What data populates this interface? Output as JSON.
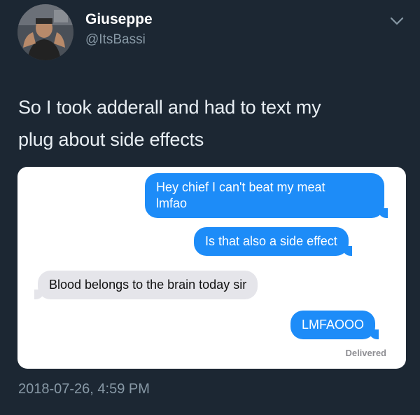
{
  "author": {
    "name": "Giuseppe",
    "handle": "@ItsBassi",
    "avatar_icon": "profile-photo"
  },
  "tweet": {
    "text_line1": "So I took adderall and had to text my",
    "text_line2": "plug about side effects",
    "timestamp": "2018-07-26, 4:59 PM"
  },
  "menu_icon": "chevron-down-icon",
  "conversation": {
    "messages": [
      {
        "from": "me",
        "line1": "Hey chief I can't beat my meat",
        "line2": "lmfao"
      },
      {
        "from": "me",
        "text": "Is that also a side effect"
      },
      {
        "from": "them",
        "text": "Blood belongs to the brain today sir"
      },
      {
        "from": "me",
        "text": "LMFAOOO"
      }
    ],
    "status": "Delivered"
  },
  "colors": {
    "background": "#1c2733",
    "sent_bubble": "#1d8cf8",
    "received_bubble": "#e5e5ea",
    "secondary_text": "#8899a6"
  }
}
